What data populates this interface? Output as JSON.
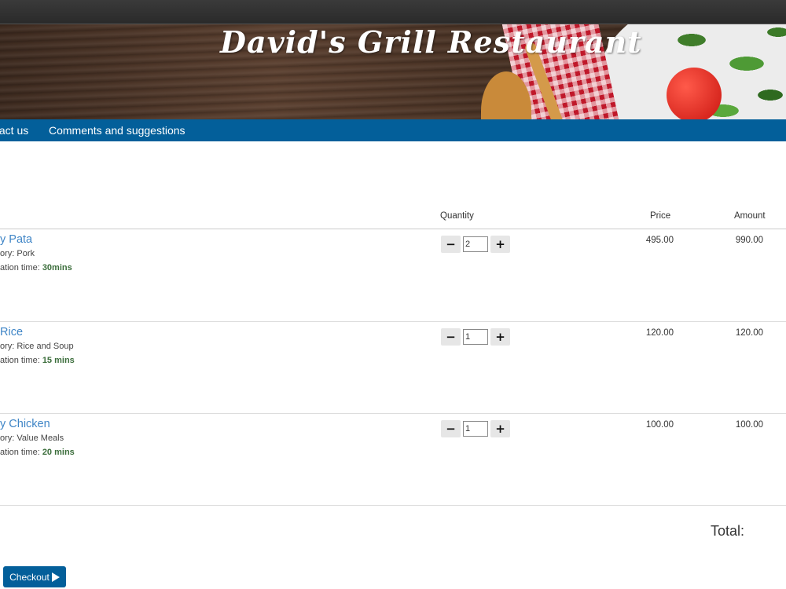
{
  "header": {
    "title": "David's Grill Restaurant"
  },
  "nav": {
    "items": [
      {
        "label": "tact us"
      },
      {
        "label": "Comments and suggestions"
      }
    ]
  },
  "table": {
    "columns": {
      "quantity": "Quantity",
      "price": "Price",
      "amount": "Amount"
    },
    "rows": [
      {
        "name": "y Pata",
        "category_prefix": "ory: ",
        "category": "Pork",
        "prep_prefix": "ation time: ",
        "prep_time": "30mins",
        "quantity": "2",
        "price": "495.00",
        "amount": "990.00"
      },
      {
        "name": " Rice",
        "category_prefix": "ory: ",
        "category": "Rice and Soup",
        "prep_prefix": "ation time: ",
        "prep_time": "15 mins",
        "quantity": "1",
        "price": "120.00",
        "amount": "120.00"
      },
      {
        "name": "y Chicken",
        "category_prefix": "ory: ",
        "category": "Value Meals",
        "prep_prefix": "ation time: ",
        "prep_time": "20 mins",
        "quantity": "1",
        "price": "100.00",
        "amount": "100.00"
      }
    ],
    "decrement_symbol": "−",
    "increment_symbol": "+"
  },
  "summary": {
    "total_label": "Total:"
  },
  "checkout": {
    "label": "Checkout",
    "icon": "play-icon"
  },
  "colors": {
    "nav_bg": "#035f9a",
    "item_link": "#3f85c6",
    "prep_time": "#3c6e3c"
  }
}
